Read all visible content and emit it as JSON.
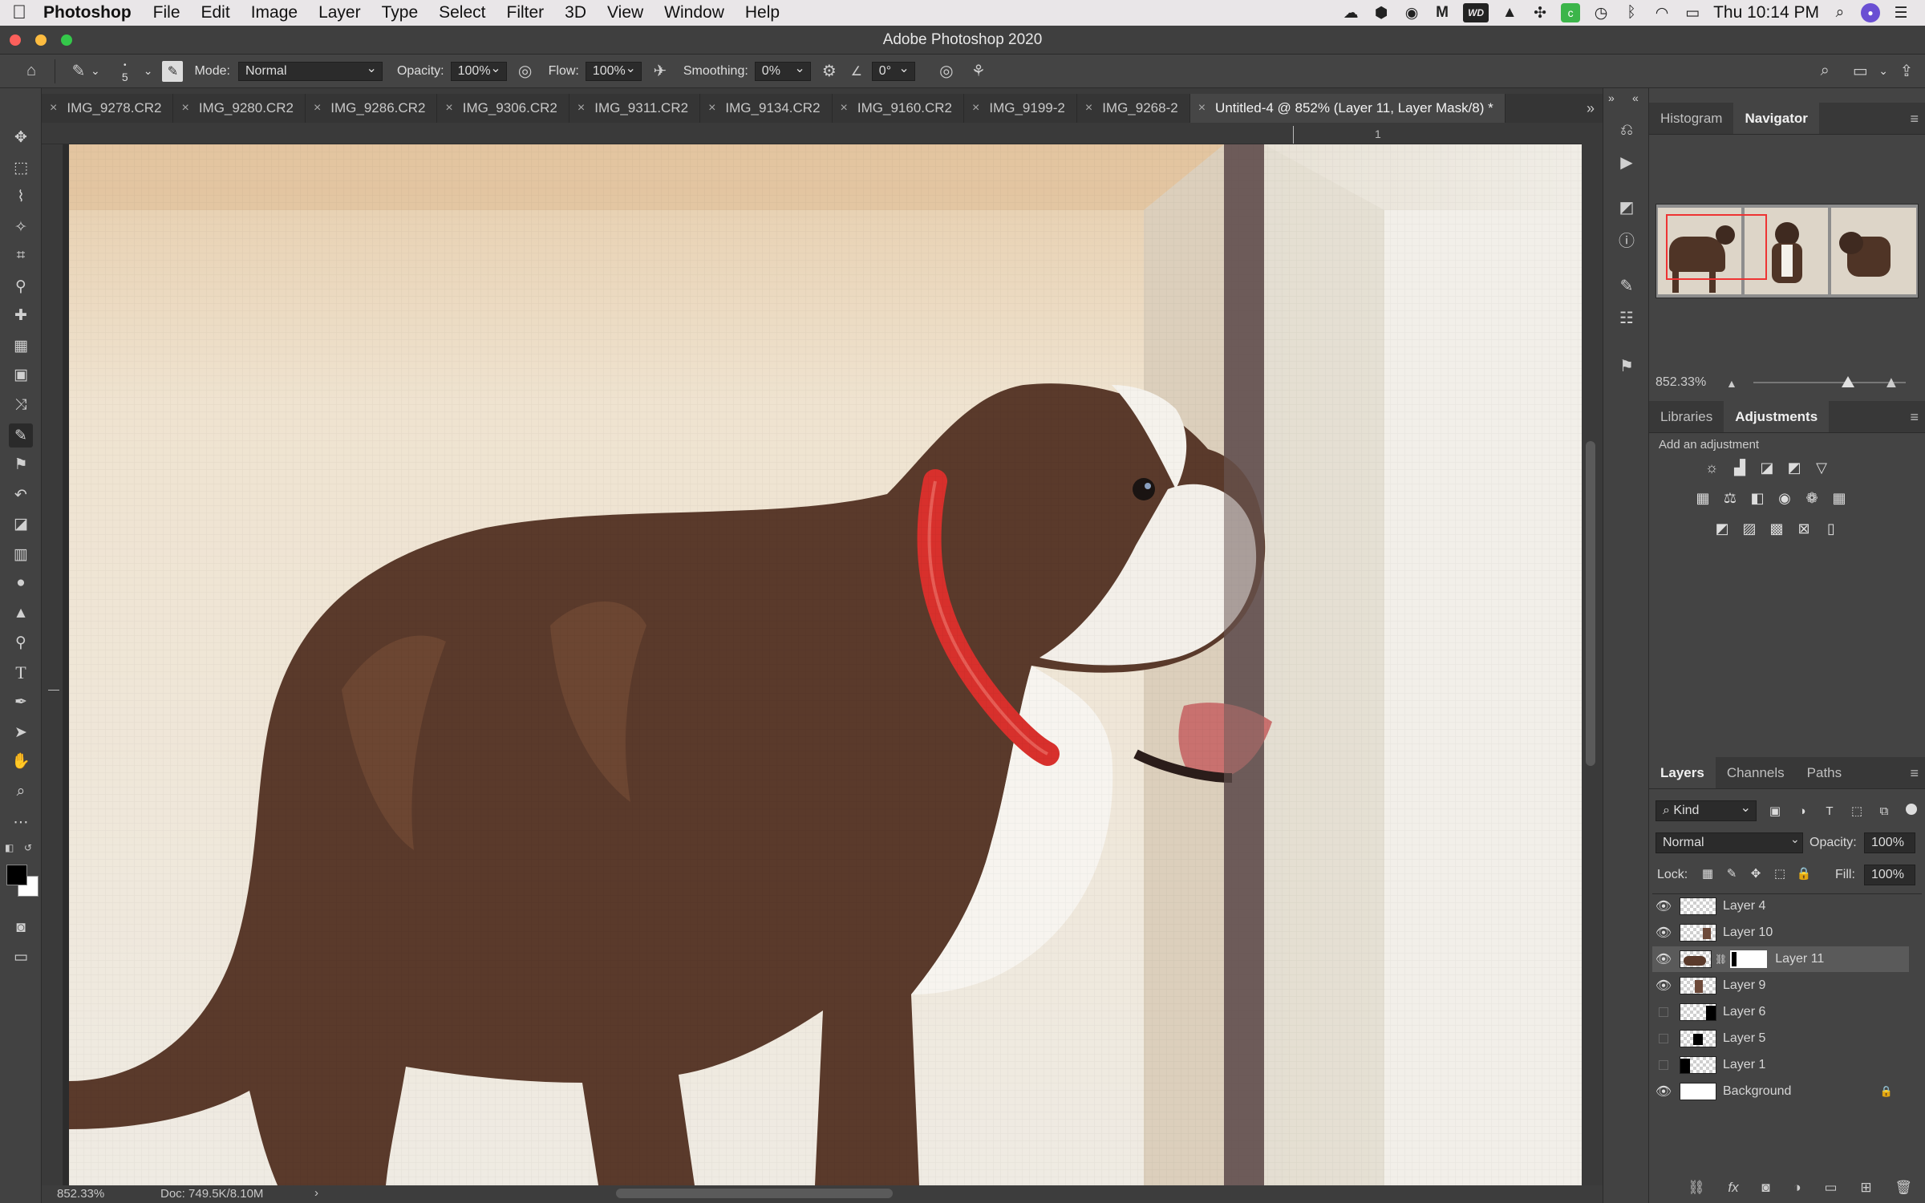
{
  "menubar": {
    "app": "Photoshop",
    "items": [
      "File",
      "Edit",
      "Image",
      "Layer",
      "Type",
      "Select",
      "Filter",
      "3D",
      "View",
      "Window",
      "Help"
    ],
    "clock": "Thu 10:14 PM",
    "wd_label": "WD"
  },
  "window": {
    "title": "Adobe Photoshop 2020"
  },
  "options": {
    "brush_size": "5",
    "mode_label": "Mode:",
    "mode_value": "Normal",
    "opacity_label": "Opacity:",
    "opacity_value": "100%",
    "flow_label": "Flow:",
    "flow_value": "100%",
    "smoothing_label": "Smoothing:",
    "smoothing_value": "0%",
    "angle_value": "0°"
  },
  "tabs": [
    {
      "label": "IMG_9278.CR2"
    },
    {
      "label": "IMG_9280.CR2"
    },
    {
      "label": "IMG_9286.CR2"
    },
    {
      "label": "IMG_9306.CR2"
    },
    {
      "label": "IMG_9311.CR2"
    },
    {
      "label": "IMG_9134.CR2"
    },
    {
      "label": "IMG_9160.CR2"
    },
    {
      "label": "IMG_9199-2"
    },
    {
      "label": "IMG_9268-2"
    },
    {
      "label": "Untitled-4 @ 852% (Layer 11, Layer Mask/8) *"
    }
  ],
  "ruler": {
    "mark": "1"
  },
  "status": {
    "zoom": "852.33%",
    "doc": "Doc: 749.5K/8.10M"
  },
  "navigator": {
    "tabs": [
      "Histogram",
      "Navigator"
    ],
    "zoom": "852.33%",
    "zoom_fraction": 0.62
  },
  "adjustments": {
    "tabs": [
      "Libraries",
      "Adjustments"
    ],
    "hint": "Add an adjustment"
  },
  "layers_panel": {
    "tabs": [
      "Layers",
      "Channels",
      "Paths"
    ],
    "filter_kind": "Kind",
    "blend_mode": "Normal",
    "opacity_label": "Opacity:",
    "opacity_value": "100%",
    "lock_label": "Lock:",
    "fill_label": "Fill:",
    "fill_value": "100%",
    "layers": [
      {
        "name": "Layer 4",
        "visible": true
      },
      {
        "name": "Layer 10",
        "visible": true
      },
      {
        "name": "Layer 11",
        "visible": true
      },
      {
        "name": "Layer 9",
        "visible": true
      },
      {
        "name": "Layer 6",
        "visible": false
      },
      {
        "name": "Layer 5",
        "visible": false
      },
      {
        "name": "Layer 1",
        "visible": false
      },
      {
        "name": "Background",
        "visible": true
      }
    ]
  },
  "colors": {
    "accent": "#3d7bd9",
    "collar": "#d8302c",
    "canvas_bg": "#efe6d8"
  }
}
